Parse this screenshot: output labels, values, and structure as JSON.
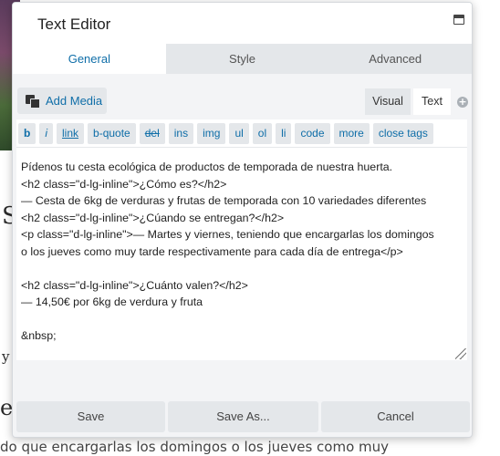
{
  "background": {
    "frag_1": "S",
    "frag_2": "y",
    "frag_3": "e",
    "tail_text": "do que encargarlas los domingos o los jueves como muy"
  },
  "dialog": {
    "title": "Text Editor",
    "tabs": [
      {
        "label": "General",
        "active": true
      },
      {
        "label": "Style",
        "active": false
      },
      {
        "label": "Advanced",
        "active": false
      }
    ],
    "add_media_label": "Add Media",
    "mode_visual": "Visual",
    "mode_text": "Text",
    "quicktags": [
      "b",
      "i",
      "link",
      "b-quote",
      "del",
      "ins",
      "img",
      "ul",
      "ol",
      "li",
      "code",
      "more",
      "close tags"
    ],
    "content_lines": [
      "Pídenos tu cesta ecológica de productos de temporada de nuestra huerta.",
      "<h2 class=\"d-lg-inline\">¿Cómo es?</h2>",
      "— Cesta de 6kg de verduras y frutas de temporada con 10 variedades diferentes",
      "<h2 class=\"d-lg-inline\">¿Cúando se entregan?</h2>",
      "<p class=\"d-lg-inline\">— Martes y viernes, teniendo que encargarlas los domingos",
      "o los jueves como muy tarde respectivamente para cada día de entrega</p>",
      "",
      "<h2 class=\"d-lg-inline\">¿Cuánto valen?</h2>",
      "— 14,50€ por 6kg de verdura y fruta",
      "",
      "&nbsp;"
    ],
    "footer": {
      "save": "Save",
      "save_as": "Save As...",
      "cancel": "Cancel"
    }
  },
  "colors": {
    "accent": "#0f6ea8",
    "button_bg": "#e4e7ea",
    "panel_bg": "#f3f4f6"
  }
}
